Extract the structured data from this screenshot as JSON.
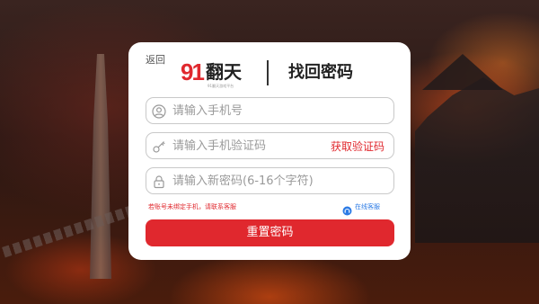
{
  "back_label": "返回",
  "logo": {
    "number": "91",
    "name": "翻天",
    "subtitle": "91翻天游戏平台"
  },
  "title": "找回密码",
  "fields": [
    {
      "name": "phone",
      "icon": "user-icon",
      "placeholder": "请输入手机号"
    },
    {
      "name": "code",
      "icon": "key-icon",
      "placeholder": "请输入手机验证码",
      "action": "获取验证码"
    },
    {
      "name": "password",
      "icon": "lock-icon",
      "placeholder": "请输入新密码(6-16个字符)"
    }
  ],
  "help_note": "若账号未绑定手机，请联系客服",
  "service": {
    "icon": "customer-service-icon",
    "label": "在线客服"
  },
  "submit_label": "重置密码",
  "colors": {
    "accent": "#e0282e",
    "link": "#2c7be5"
  }
}
